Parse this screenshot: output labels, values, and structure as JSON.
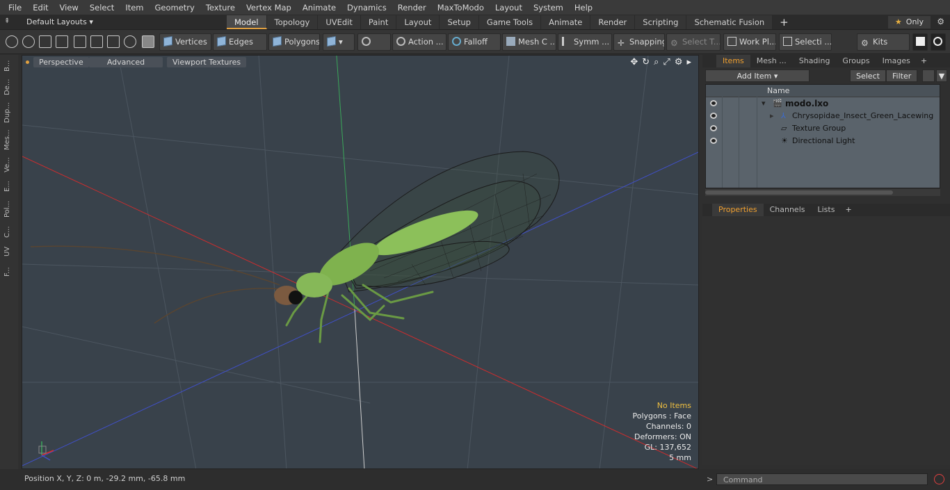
{
  "menu": [
    "File",
    "Edit",
    "View",
    "Select",
    "Item",
    "Geometry",
    "Texture",
    "Vertex Map",
    "Animate",
    "Dynamics",
    "Render",
    "MaxToModo",
    "Layout",
    "System",
    "Help"
  ],
  "layout_bar": {
    "layouts_label": "Default Layouts",
    "tabs": [
      "Model",
      "Topology",
      "UVEdit",
      "Paint",
      "Layout",
      "Setup",
      "Game Tools",
      "Animate",
      "Render",
      "Scripting",
      "Schematic Fusion"
    ],
    "active_tab": "Model",
    "only_label": "Only"
  },
  "toolbar": {
    "vertices": "Vertices",
    "edges": "Edges",
    "polygons": "Polygons",
    "action": "Action ...",
    "falloff": "Falloff",
    "mesh": "Mesh C ...",
    "symm": "Symm ...",
    "snapping": "Snapping",
    "select_t": "Select T...",
    "work_pl": "Work Pl...",
    "selecti": "Selecti ...",
    "kits": "Kits"
  },
  "left_strip": [
    "B...",
    "De...",
    "Dup...",
    "Mes...",
    "Ve...",
    "E...",
    "Pol...",
    "C...",
    "UV",
    "F..."
  ],
  "viewport": {
    "perspective": "Perspective",
    "advanced": "Advanced",
    "textures": "Viewport Textures",
    "info": {
      "no_items": "No Items",
      "polygons": "Polygons : Face",
      "channels": "Channels: 0",
      "deformers": "Deformers: ON",
      "gl": "GL: 137,652",
      "scale": "5 mm"
    },
    "colors": {
      "bg": "#39424b",
      "x_axis": "#e02a2a",
      "y_axis": "#3aa85a",
      "z_axis": "#4050c8",
      "body": "#8cc05a"
    }
  },
  "status": {
    "position": "Position X, Y, Z:   0 m, -29.2 mm, -65.8 mm"
  },
  "items_panel": {
    "tabs": [
      "Items",
      "Mesh ...",
      "Shading",
      "Groups",
      "Images"
    ],
    "active_tab": "Items",
    "add_item": "Add Item",
    "select": "Select",
    "filter": "Filter",
    "column_name": "Name",
    "rows": [
      {
        "label": "modo.lxo",
        "icon": "scene-icon"
      },
      {
        "label": "Chrysopidae_Insect_Green_Lacewing",
        "icon": "mesh-icon"
      },
      {
        "label": "Texture Group",
        "icon": "texture-group-icon"
      },
      {
        "label": "Directional Light",
        "icon": "light-icon"
      }
    ]
  },
  "properties_panel": {
    "tabs": [
      "Properties",
      "Channels",
      "Lists"
    ],
    "active_tab": "Properties"
  },
  "command": {
    "placeholder": "Command"
  }
}
